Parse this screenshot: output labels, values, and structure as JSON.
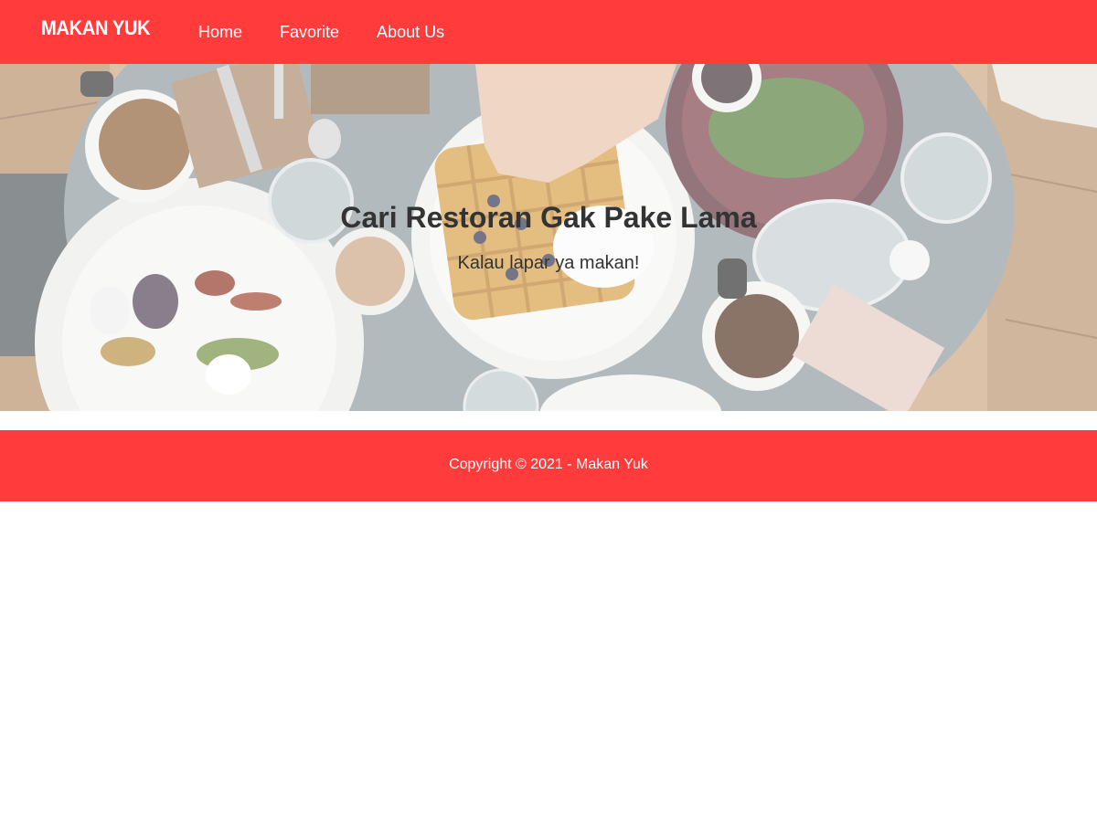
{
  "navbar": {
    "brand": "MAKAN YUK",
    "links": [
      {
        "label": "Home"
      },
      {
        "label": "Favorite"
      },
      {
        "label": "About Us"
      }
    ]
  },
  "hero": {
    "title": "Cari Restoran Gak Pake Lama",
    "subtitle": "Kalau lapar ya makan!"
  },
  "footer": {
    "copyright": "Copyright © 2021 - Makan Yuk"
  },
  "colors": {
    "primary": "#ff3b3b",
    "text_dark": "#333333",
    "text_light": "#ffffff"
  }
}
